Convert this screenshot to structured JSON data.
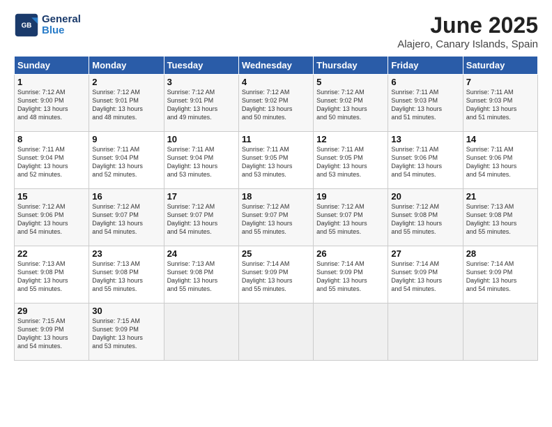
{
  "logo": {
    "line1": "General",
    "line2": "Blue"
  },
  "title": "June 2025",
  "subtitle": "Alajero, Canary Islands, Spain",
  "weekdays": [
    "Sunday",
    "Monday",
    "Tuesday",
    "Wednesday",
    "Thursday",
    "Friday",
    "Saturday"
  ],
  "weeks": [
    [
      {
        "day": "1",
        "rise": "7:12 AM",
        "set": "9:00 PM",
        "daylight": "13 hours and 48 minutes."
      },
      {
        "day": "2",
        "rise": "7:12 AM",
        "set": "9:01 PM",
        "daylight": "13 hours and 48 minutes."
      },
      {
        "day": "3",
        "rise": "7:12 AM",
        "set": "9:01 PM",
        "daylight": "13 hours and 49 minutes."
      },
      {
        "day": "4",
        "rise": "7:12 AM",
        "set": "9:02 PM",
        "daylight": "13 hours and 50 minutes."
      },
      {
        "day": "5",
        "rise": "7:12 AM",
        "set": "9:02 PM",
        "daylight": "13 hours and 50 minutes."
      },
      {
        "day": "6",
        "rise": "7:11 AM",
        "set": "9:03 PM",
        "daylight": "13 hours and 51 minutes."
      },
      {
        "day": "7",
        "rise": "7:11 AM",
        "set": "9:03 PM",
        "daylight": "13 hours and 51 minutes."
      }
    ],
    [
      {
        "day": "8",
        "rise": "7:11 AM",
        "set": "9:04 PM",
        "daylight": "13 hours and 52 minutes."
      },
      {
        "day": "9",
        "rise": "7:11 AM",
        "set": "9:04 PM",
        "daylight": "13 hours and 52 minutes."
      },
      {
        "day": "10",
        "rise": "7:11 AM",
        "set": "9:04 PM",
        "daylight": "13 hours and 53 minutes."
      },
      {
        "day": "11",
        "rise": "7:11 AM",
        "set": "9:05 PM",
        "daylight": "13 hours and 53 minutes."
      },
      {
        "day": "12",
        "rise": "7:11 AM",
        "set": "9:05 PM",
        "daylight": "13 hours and 53 minutes."
      },
      {
        "day": "13",
        "rise": "7:11 AM",
        "set": "9:06 PM",
        "daylight": "13 hours and 54 minutes."
      },
      {
        "day": "14",
        "rise": "7:11 AM",
        "set": "9:06 PM",
        "daylight": "13 hours and 54 minutes."
      }
    ],
    [
      {
        "day": "15",
        "rise": "7:12 AM",
        "set": "9:06 PM",
        "daylight": "13 hours and 54 minutes."
      },
      {
        "day": "16",
        "rise": "7:12 AM",
        "set": "9:07 PM",
        "daylight": "13 hours and 54 minutes."
      },
      {
        "day": "17",
        "rise": "7:12 AM",
        "set": "9:07 PM",
        "daylight": "13 hours and 54 minutes."
      },
      {
        "day": "18",
        "rise": "7:12 AM",
        "set": "9:07 PM",
        "daylight": "13 hours and 55 minutes."
      },
      {
        "day": "19",
        "rise": "7:12 AM",
        "set": "9:07 PM",
        "daylight": "13 hours and 55 minutes."
      },
      {
        "day": "20",
        "rise": "7:12 AM",
        "set": "9:08 PM",
        "daylight": "13 hours and 55 minutes."
      },
      {
        "day": "21",
        "rise": "7:13 AM",
        "set": "9:08 PM",
        "daylight": "13 hours and 55 minutes."
      }
    ],
    [
      {
        "day": "22",
        "rise": "7:13 AM",
        "set": "9:08 PM",
        "daylight": "13 hours and 55 minutes."
      },
      {
        "day": "23",
        "rise": "7:13 AM",
        "set": "9:08 PM",
        "daylight": "13 hours and 55 minutes."
      },
      {
        "day": "24",
        "rise": "7:13 AM",
        "set": "9:08 PM",
        "daylight": "13 hours and 55 minutes."
      },
      {
        "day": "25",
        "rise": "7:14 AM",
        "set": "9:09 PM",
        "daylight": "13 hours and 55 minutes."
      },
      {
        "day": "26",
        "rise": "7:14 AM",
        "set": "9:09 PM",
        "daylight": "13 hours and 55 minutes."
      },
      {
        "day": "27",
        "rise": "7:14 AM",
        "set": "9:09 PM",
        "daylight": "13 hours and 54 minutes."
      },
      {
        "day": "28",
        "rise": "7:14 AM",
        "set": "9:09 PM",
        "daylight": "13 hours and 54 minutes."
      }
    ],
    [
      {
        "day": "29",
        "rise": "7:15 AM",
        "set": "9:09 PM",
        "daylight": "13 hours and 54 minutes."
      },
      {
        "day": "30",
        "rise": "7:15 AM",
        "set": "9:09 PM",
        "daylight": "13 hours and 53 minutes."
      },
      null,
      null,
      null,
      null,
      null
    ]
  ]
}
